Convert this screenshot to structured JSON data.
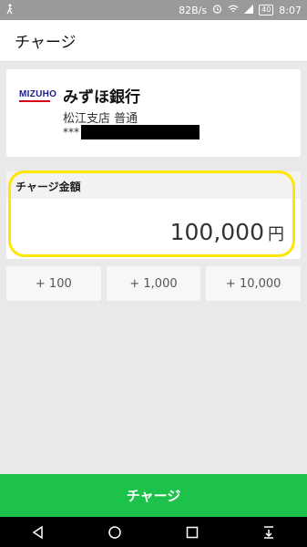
{
  "status": {
    "speed": "82B/s",
    "battery": "40",
    "time": "8:07",
    "icons": [
      "walking-icon",
      "alarm-icon",
      "wifi-icon",
      "signal-icon",
      "battery-icon"
    ]
  },
  "app": {
    "title": "チャージ"
  },
  "bank": {
    "logo_text": "MIZUHO",
    "name": "みずほ銀行",
    "branch": "松江支店 普通",
    "account_prefix": "***"
  },
  "amount": {
    "label": "チャージ金額",
    "value": "100,000",
    "unit": "円"
  },
  "quick_amounts": [
    "+ 100",
    "+ 1,000",
    "+ 10,000"
  ],
  "charge_button": {
    "label": "チャージ"
  },
  "colors": {
    "accent": "#1dc24a",
    "highlight": "#ffe600"
  },
  "nav": [
    "back-icon",
    "home-icon",
    "recents-icon",
    "download-icon"
  ]
}
